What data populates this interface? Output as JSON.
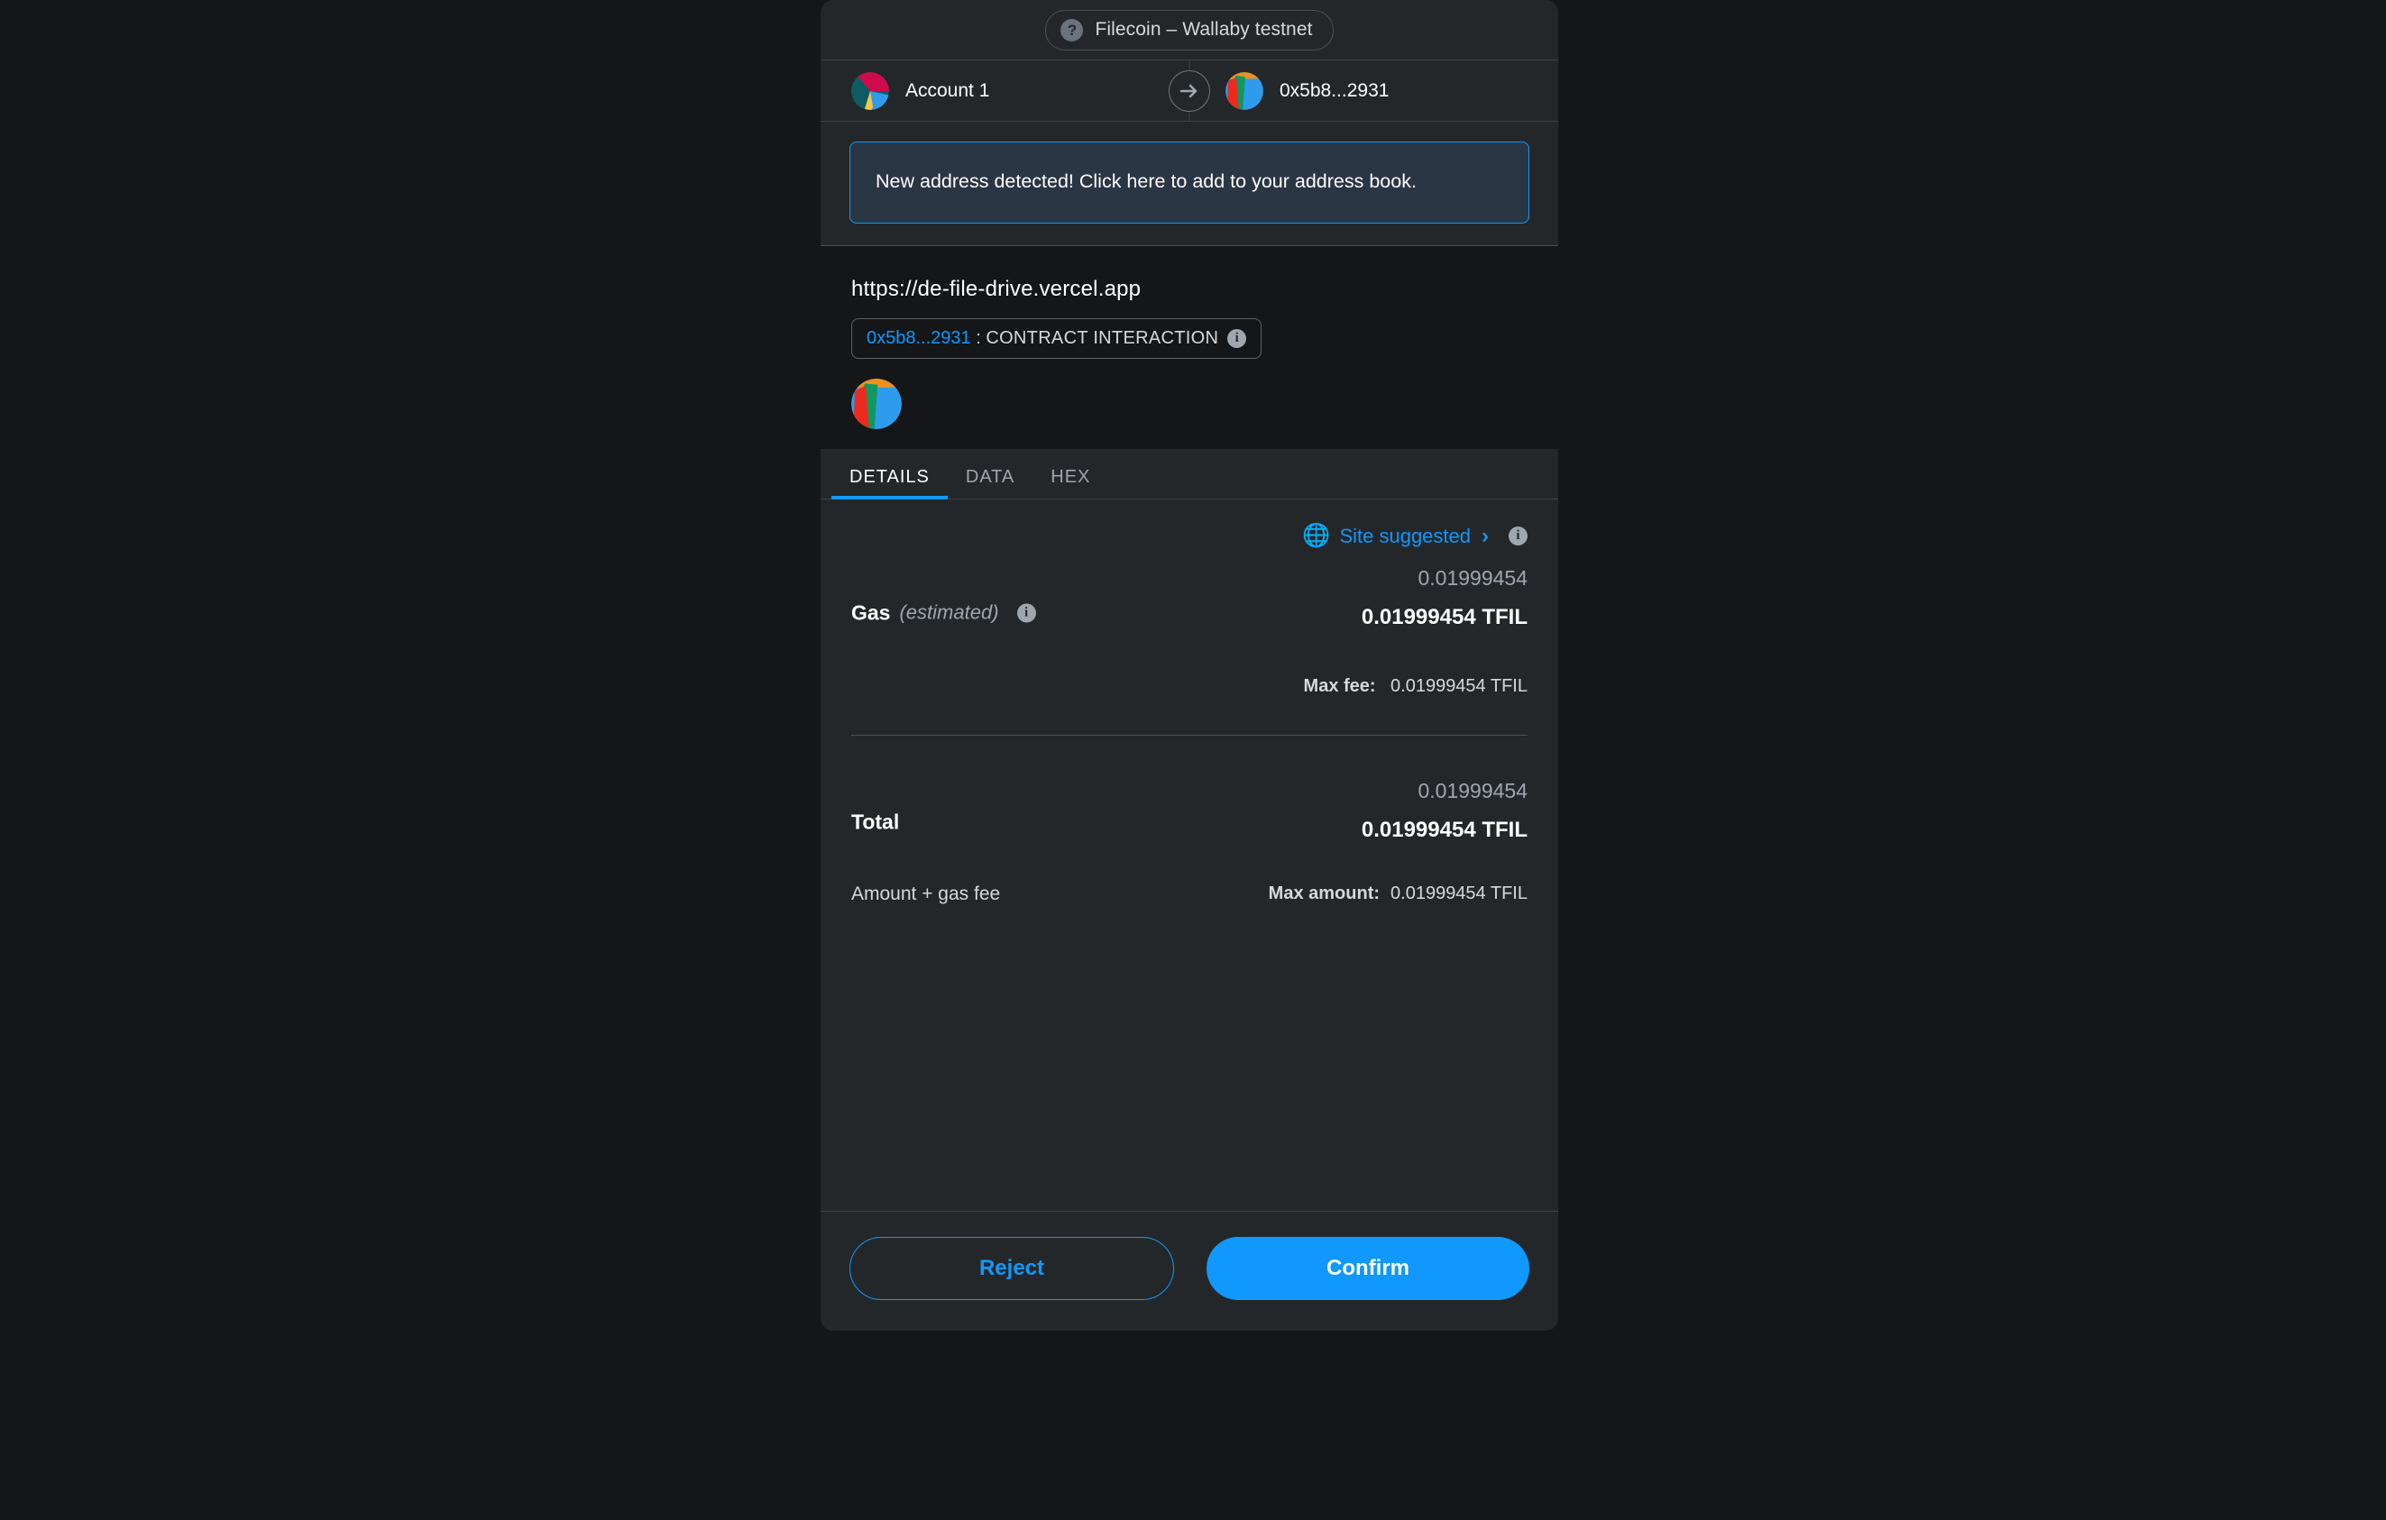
{
  "network": {
    "icon": "question-mark-icon",
    "name": "Filecoin – Wallaby testnet"
  },
  "accounts": {
    "from": {
      "label": "Account 1",
      "avatar": "identicon-account-1"
    },
    "to": {
      "label": "0x5b8...2931",
      "avatar": "identicon-recipient"
    },
    "direction_icon": "arrow-right-icon"
  },
  "banner": {
    "message": "New address detected! Click here to add to your address book."
  },
  "origin": {
    "url": "https://de-file-drive.vercel.app",
    "contract_address": "0x5b8...2931",
    "separator": ":",
    "interaction_type": "CONTRACT INTERACTION",
    "info_icon": "info-icon",
    "avatar": "identicon-contract"
  },
  "tabs": [
    {
      "label": "DETAILS",
      "active": true
    },
    {
      "label": "DATA",
      "active": false
    },
    {
      "label": "HEX",
      "active": false
    }
  ],
  "details": {
    "site_suggested": {
      "icon": "globe-icon",
      "label": "Site suggested",
      "chevron": "›",
      "info_icon": "info-icon"
    },
    "gas": {
      "title": "Gas",
      "subtitle": "(estimated)",
      "info_icon": "info-icon",
      "native_value": "0.01999454",
      "fiat_value": "0.01999454 TFIL",
      "max_fee_label": "Max fee:",
      "max_fee_value": "0.01999454 TFIL"
    },
    "total": {
      "title": "Total",
      "native_value": "0.01999454",
      "fiat_value": "0.01999454 TFIL",
      "note": "Amount + gas fee",
      "max_amount_label": "Max amount:",
      "max_amount_value": "0.01999454 TFIL"
    }
  },
  "footer": {
    "reject_label": "Reject",
    "confirm_label": "Confirm"
  },
  "colors": {
    "accent": "#1098fc",
    "panel": "#24272a",
    "page_background": "#141618",
    "banner_background": "#2b3644",
    "muted_text": "#9fa6ae"
  }
}
